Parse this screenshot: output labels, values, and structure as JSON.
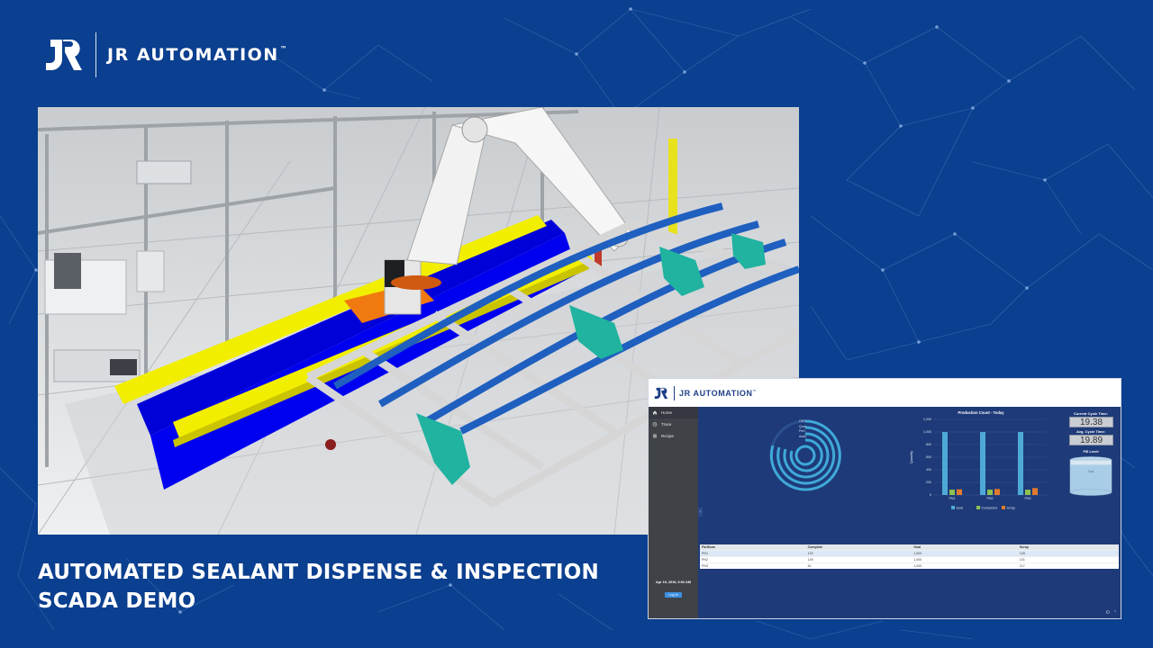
{
  "brand": {
    "name": "JR AUTOMATION",
    "trademark": "™",
    "logo_icon": "jr-monogram-icon"
  },
  "scene": {
    "description_icon": "robot-arm-sealant-cell-icon"
  },
  "title": {
    "line1": "AUTOMATED SEALANT DISPENSE & INSPECTION",
    "line2": "SCADA DEMO"
  },
  "scada": {
    "header": {
      "logo_text": "JR AUTOMATION",
      "logo_trademark": "™"
    },
    "sidebar": {
      "items": [
        {
          "label": "Home",
          "icon": "home-icon"
        },
        {
          "label": "Trace",
          "icon": "clock-icon"
        },
        {
          "label": "Recipe",
          "icon": "list-icon"
        }
      ],
      "date": "Apr 19, 2019, 9:02 AM",
      "login_label": "Log In",
      "collapse_glyph": "‹"
    },
    "oee": {
      "legend": [
        "OEE",
        "Qual.",
        "Perf.",
        "Avail."
      ]
    },
    "chart_data": {
      "type": "bar",
      "title": "Production Count - Today",
      "ylabel": "Quantity",
      "xlabel": "",
      "categories": [
        "PN1",
        "PN2",
        "PN3"
      ],
      "series": [
        {
          "name": "Goal",
          "values": [
            1000,
            1000,
            1000
          ],
          "color": "#4fa9d6"
        },
        {
          "name": "Completed",
          "values": [
            85,
            85,
            85
          ],
          "color": "#8ec24f"
        },
        {
          "name": "Scrap",
          "values": [
            90,
            95,
            110
          ],
          "color": "#e07a2e"
        }
      ],
      "ylim": [
        0,
        1200
      ],
      "yticks": [
        "0",
        "200",
        "400",
        "600",
        "800",
        "1,000",
        "1,200"
      ],
      "legend_position": "bottom",
      "grid": true
    },
    "cycle": {
      "current_label": "Current Cycle Time:",
      "current_value": "19.38",
      "avg_label": "Avg. Cycle Time:",
      "avg_value": "19.89",
      "fill_label": "Fill Level",
      "tank_label": "Tank",
      "fill_level": 0.85
    },
    "table": {
      "headers": [
        "PartNum",
        "Complete",
        "Goal",
        "Scrap"
      ],
      "rows": [
        [
          "PN1",
          "100",
          "1,000",
          "128"
        ],
        [
          "PN2",
          "149",
          "1,000",
          "101"
        ],
        [
          "PN3",
          "81",
          "1,000",
          "117"
        ]
      ]
    },
    "footer": {
      "power_glyph": "⏻",
      "up_glyph": "⌃"
    }
  }
}
